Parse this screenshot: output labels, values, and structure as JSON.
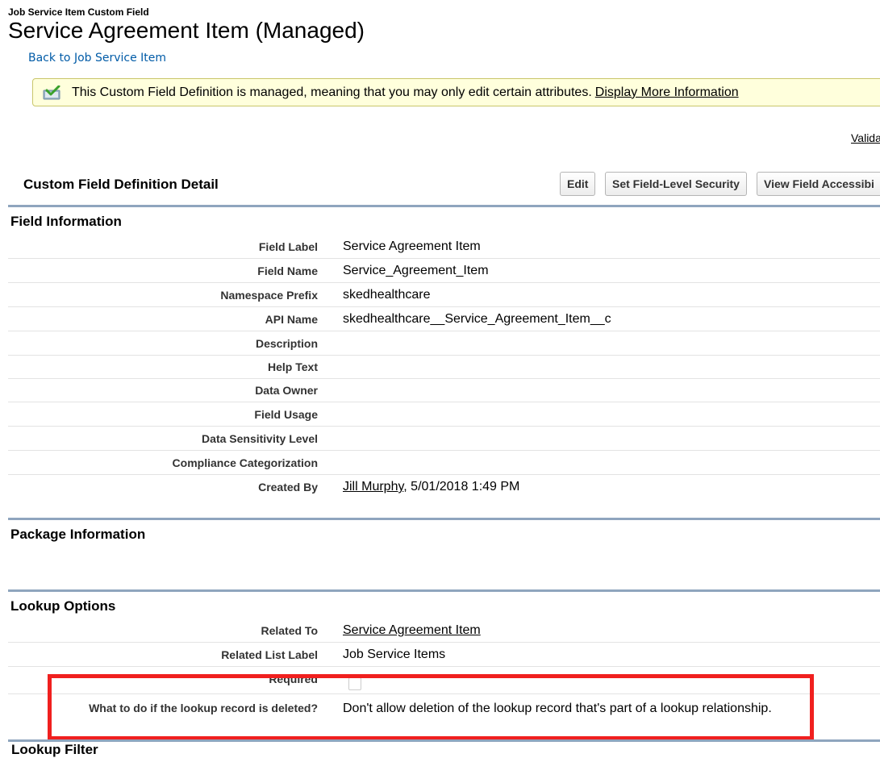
{
  "header": {
    "object_type": "Job Service Item Custom Field",
    "title": "Service Agreement Item (Managed)",
    "back_link": "Back to Job Service Item"
  },
  "notice": {
    "text": "This Custom Field Definition is managed, meaning that you may only edit certain attributes.",
    "link": "Display More Information",
    "icon": "checkmark-icon"
  },
  "validation_link": "Valida",
  "detail": {
    "title": "Custom Field Definition Detail",
    "buttons": {
      "edit": "Edit",
      "field_level_security": "Set Field-Level Security",
      "field_accessibility": "View Field Accessibi"
    }
  },
  "field_information": {
    "heading": "Field Information",
    "rows": [
      {
        "label": "Field Label",
        "value": "Service Agreement Item"
      },
      {
        "label": "Field Name",
        "value": "Service_Agreement_Item"
      },
      {
        "label": "Namespace Prefix",
        "value": "skedhealthcare"
      },
      {
        "label": "API Name",
        "value": "skedhealthcare__Service_Agreement_Item__c"
      },
      {
        "label": "Description",
        "value": ""
      },
      {
        "label": "Help Text",
        "value": ""
      },
      {
        "label": "Data Owner",
        "value": ""
      },
      {
        "label": "Field Usage",
        "value": ""
      },
      {
        "label": "Data Sensitivity Level",
        "value": ""
      },
      {
        "label": "Compliance Categorization",
        "value": ""
      },
      {
        "label": "Created By",
        "value_link": "Jill Murphy",
        "value_rest": ", 5/01/2018 1:49 PM"
      }
    ]
  },
  "package_information": {
    "heading": "Package Information"
  },
  "lookup_options": {
    "heading": "Lookup Options",
    "rows": [
      {
        "label": "Related To",
        "value": "Service Agreement Item"
      },
      {
        "label": "Related List Label",
        "value": "Job Service Items"
      },
      {
        "label": "Required",
        "value": ""
      },
      {
        "label": "What to do if the lookup record is deleted?",
        "value": "Don't allow deletion of the lookup record that's part of a lookup relationship."
      }
    ]
  },
  "next_section_partial": "Lookup Filter"
}
